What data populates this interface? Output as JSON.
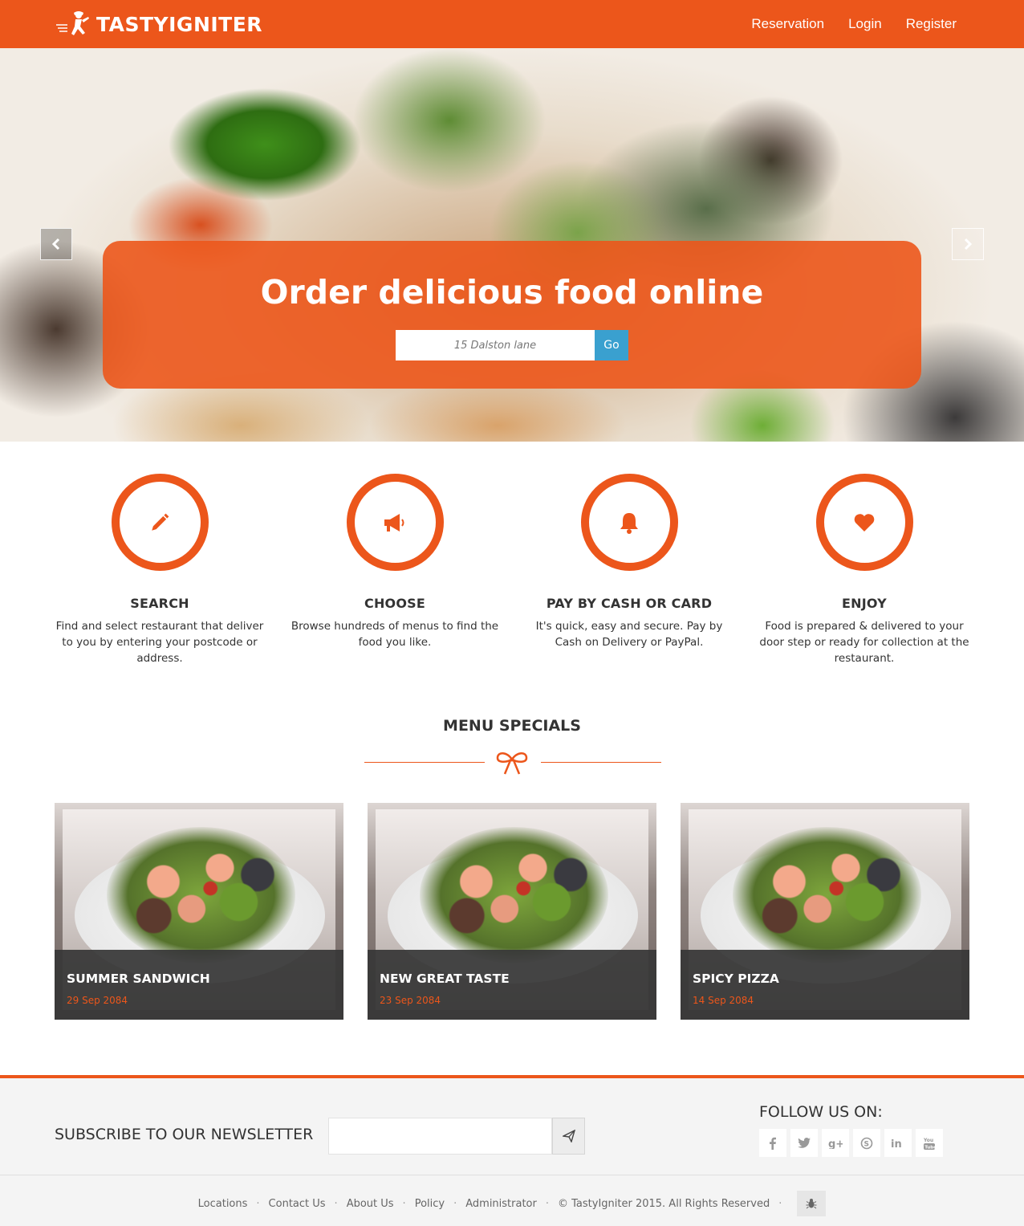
{
  "header": {
    "brand": "TASTYIGNITER",
    "nav": [
      "Reservation",
      "Login",
      "Register"
    ]
  },
  "hero": {
    "title": "Order delicious food online",
    "search_placeholder": "15 Dalston lane",
    "go_label": "Go"
  },
  "steps": [
    {
      "title": "SEARCH",
      "text": "Find and select restaurant that deliver to you by entering your postcode or address.",
      "icon": "pencil-icon"
    },
    {
      "title": "CHOOSE",
      "text": "Browse hundreds of menus to find the food you like.",
      "icon": "megaphone-icon"
    },
    {
      "title": "PAY BY CASH OR CARD",
      "text": "It's quick, easy and secure. Pay by Cash on Delivery or PayPal.",
      "icon": "bell-icon"
    },
    {
      "title": "ENJOY",
      "text": "Food is prepared & delivered to your door step or ready for collection at the restaurant.",
      "icon": "heart-icon"
    }
  ],
  "menu_specials": {
    "title": "MENU SPECIALS",
    "items": [
      {
        "title": "SUMMER SANDWICH",
        "date": "29 Sep 2084"
      },
      {
        "title": "NEW GREAT TASTE",
        "date": "23 Sep 2084"
      },
      {
        "title": "SPICY PIZZA",
        "date": "14 Sep 2084"
      }
    ]
  },
  "newsletter": {
    "label": "SUBSCRIBE TO OUR NEWSLETTER"
  },
  "follow": {
    "label": "FOLLOW US ON:",
    "networks": [
      "facebook-icon",
      "twitter-icon",
      "google-plus-icon",
      "skype-icon",
      "linkedin-icon",
      "youtube-icon"
    ]
  },
  "footer": {
    "links": [
      "Locations",
      "Contact Us",
      "About Us",
      "Policy",
      "Administrator"
    ],
    "copyright": "© TastyIgniter 2015. All Rights Reserved"
  },
  "colors": {
    "brand": "#ec561b",
    "go_button": "#3aa0cf",
    "caption_bg": "#373737"
  }
}
